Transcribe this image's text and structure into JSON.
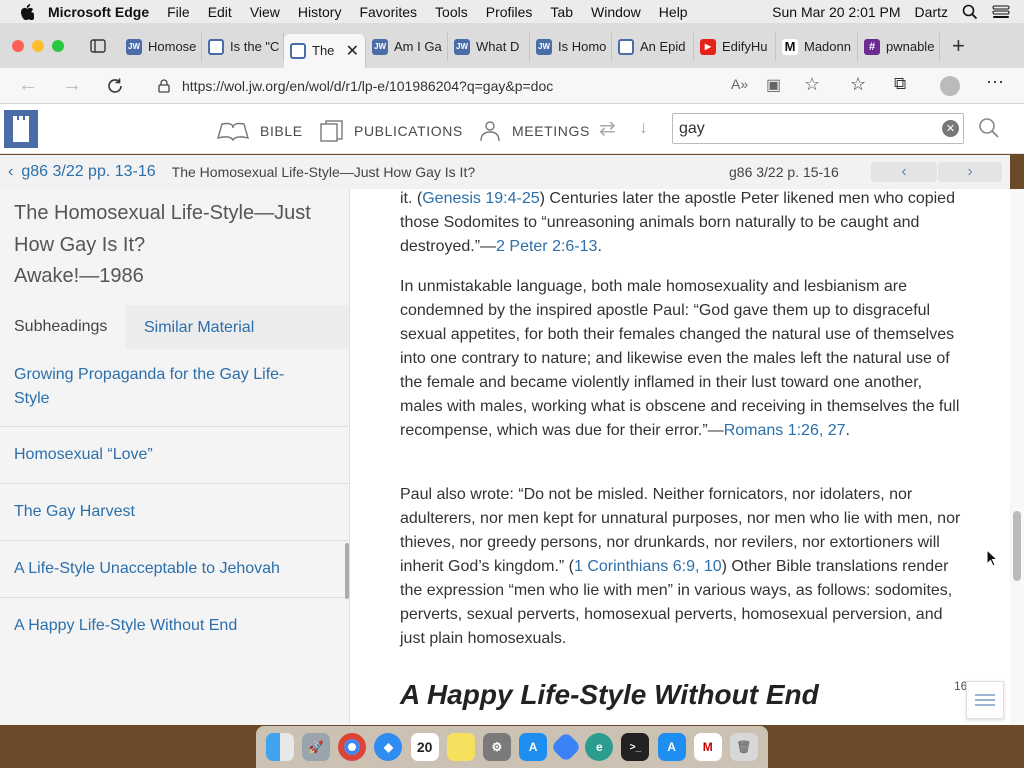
{
  "menubar": {
    "app": "Microsoft Edge",
    "menus": [
      "File",
      "Edit",
      "View",
      "History",
      "Favorites",
      "Tools",
      "Profiles",
      "Tab",
      "Window",
      "Help"
    ],
    "datetime": "Sun Mar 20  2:01 PM",
    "user": "Dartz"
  },
  "tabs": [
    {
      "title": "Homose",
      "favicon": "JW"
    },
    {
      "title": "Is the \"C",
      "favicon": "doc"
    },
    {
      "title": "The",
      "favicon": "doc"
    },
    {
      "title": "Am I Ga",
      "favicon": "JW"
    },
    {
      "title": "What D",
      "favicon": "JW"
    },
    {
      "title": "Is Homo",
      "favicon": "JW"
    },
    {
      "title": "An Epid",
      "favicon": "doc"
    },
    {
      "title": "EdifyHu",
      "favicon": "yt"
    },
    {
      "title": "Madonn",
      "favicon": "m"
    },
    {
      "title": "pwnable",
      "favicon": "#"
    }
  ],
  "address": {
    "url": "https://wol.jw.org/en/wol/d/r1/lp-e/101986204?q=gay&p=doc"
  },
  "site_nav": {
    "bible": "BIBLE",
    "publications": "PUBLICATIONS",
    "meetings": "MEETINGS",
    "search_value": "gay"
  },
  "subnav": {
    "prev_ref": "g86 3/22 pp. 13-16",
    "current_title": "The Homosexual Life-Style—Just How Gay Is It?",
    "next_ref": "g86 3/22 p. 15-16"
  },
  "sidebar": {
    "title": "The Homosexual Life-Style—Just How Gay Is It?",
    "source": "Awake!—1986",
    "tab_subheadings": "Subheadings",
    "tab_similar": "Similar Material",
    "items": [
      "Growing Propaganda for the Gay Life-Style",
      "Homosexual “Love”",
      "The Gay Harvest",
      "A Life-Style Unacceptable to Jehovah",
      "A Happy Life-Style Without End"
    ]
  },
  "article": {
    "p1_a": "it. (",
    "p1_link1": "Genesis 19:4-25",
    "p1_b": ") Centuries later the apostle Peter likened men who copied those Sodomites to “unreasoning animals born naturally to be caught and destroyed.”—",
    "p1_link2": "2 Peter 2:6-13",
    "p1_c": ".",
    "p2_a": "In unmistakable language, both male homosexuality and lesbianism are condemned by the inspired apostle Paul: “God gave them up to disgraceful sexual appetites, for both their females changed the natural use of themselves into one contrary to nature; and likewise even the males left the natural use of the female and became violently inflamed in their lust toward one another, males with males, working what is obscene and receiving in themselves the full recompense, which was due for their error.”—",
    "p2_link": "Romans 1:26, 27",
    "p2_b": ".",
    "p3_a": "Paul also wrote: “Do not be misled. Neither fornicators, nor idolaters, nor adulterers, nor men kept for unnatural purposes, nor men who lie with men, nor thieves, nor greedy persons, nor drunkards, nor revilers, nor extortioners will inherit God’s kingdom.” (",
    "p3_link": "1 Corinthians 6:9, 10",
    "p3_b": ") Other Bible translations render the expression “men who lie with men” in various ways, as follows: sodomites, perverts, sexual perverts, homosexual perverts, homosexual perversion, and just plain homosexuals.",
    "heading": "A Happy Life-Style Without End",
    "page_num": "16"
  },
  "dock": {
    "calendar_day": "20"
  }
}
